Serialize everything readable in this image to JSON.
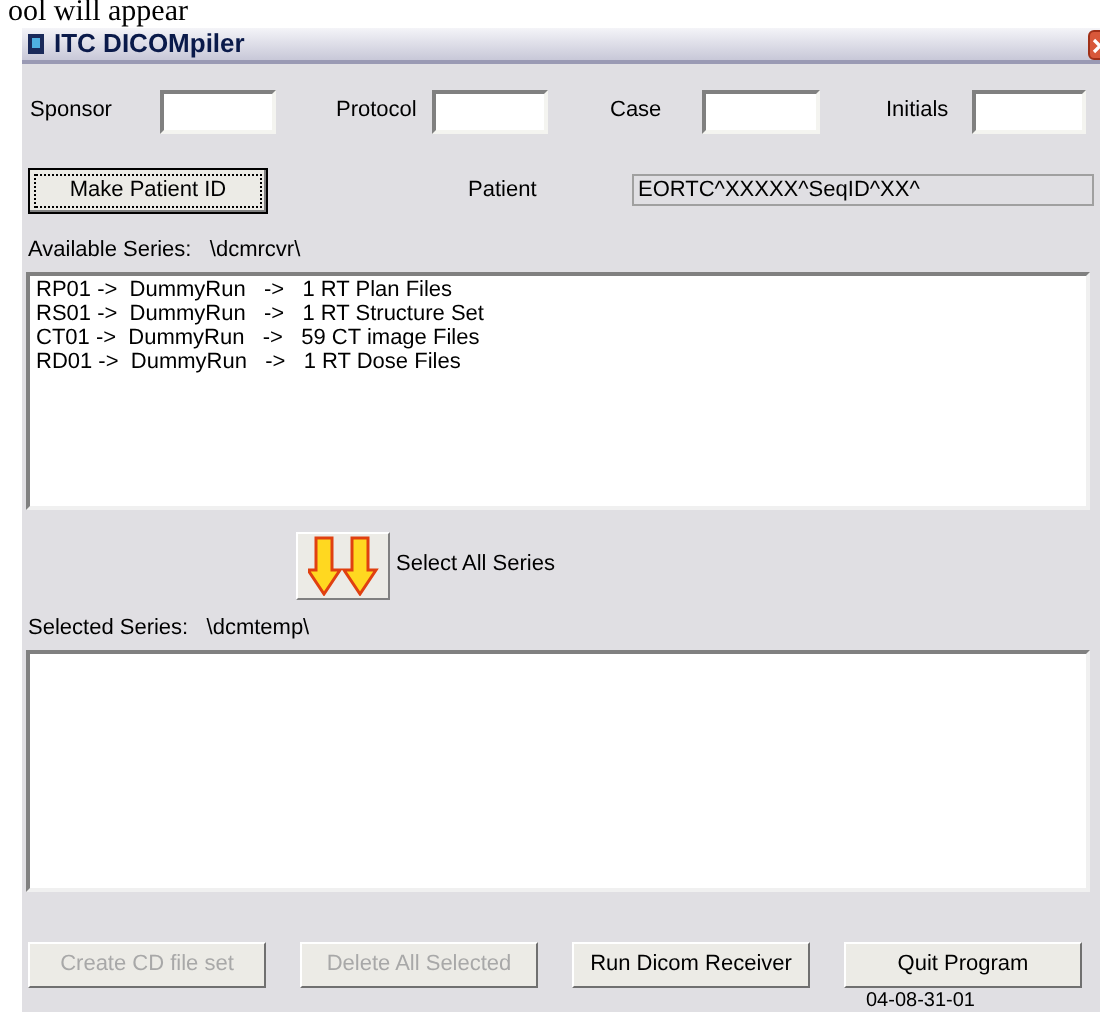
{
  "page_caption": "ool will appear",
  "window": {
    "title": "ITC DICOMpiler"
  },
  "fields": [
    {
      "label": "Sponsor"
    },
    {
      "label": "Protocol"
    },
    {
      "label": "Case"
    },
    {
      "label": "Initials"
    }
  ],
  "make_patient_id": {
    "label": "Make Patient ID",
    "disabled": false
  },
  "patient": {
    "label": "Patient",
    "value": "EORTC^XXXXX^SeqID^XX^"
  },
  "available_series": {
    "label": "Available Series:",
    "path": "\\dcmrcvr\\",
    "rows": [
      {
        "id": "RP01 ->",
        "study": "DummyRun",
        "arrow": "->",
        "files": "1 RT Plan Files"
      },
      {
        "id": "RS01 ->",
        "study": "DummyRun",
        "arrow": "->",
        "files": "1 RT Structure Set"
      },
      {
        "id": "CT01 ->",
        "study": "DummyRun",
        "arrow": "->",
        "files": "59 CT image Files"
      },
      {
        "id": "RD01 ->",
        "study": "DummyRun",
        "arrow": "->",
        "files": "1 RT Dose Files"
      }
    ]
  },
  "select_all": {
    "label": "Select All Series"
  },
  "selected_series": {
    "label": "Selected Series:",
    "path": "\\dcmtemp\\"
  },
  "buttons": [
    {
      "label": "Create CD file set",
      "disabled": true
    },
    {
      "label": "Delete All Selected",
      "disabled": true
    },
    {
      "label": "Run Dicom Receiver",
      "disabled": false
    },
    {
      "label": "Quit Program",
      "disabled": false
    }
  ],
  "version": "04-08-31-01"
}
